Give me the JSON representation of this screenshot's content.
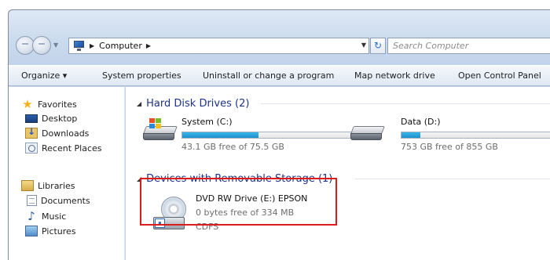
{
  "address": {
    "crumbs": [
      "Computer"
    ],
    "separator": "▶",
    "dropdown_icon": "chevron-down-icon",
    "refresh_icon": "refresh-icon"
  },
  "search": {
    "placeholder": "Search Computer"
  },
  "commands": [
    "Organize ▾",
    "System properties",
    "Uninstall or change a program",
    "Map network drive",
    "Open Control Panel"
  ],
  "nav": {
    "favorites": "Favorites",
    "desktop": "Desktop",
    "downloads": "Downloads",
    "recent_places": "Recent Places",
    "libraries": "Libraries",
    "documents": "Documents",
    "music": "Music",
    "pictures": "Pictures"
  },
  "groups": {
    "hard_disk": {
      "title": "Hard Disk Drives (2)",
      "drives": [
        {
          "name": "System (C:)",
          "free": "43.1 GB free of 75.5 GB",
          "used_fraction": 0.43
        },
        {
          "name": "Data (D:)",
          "free": "753 GB free of 855 GB",
          "used_fraction": 0.12
        }
      ]
    },
    "removable": {
      "title": "Devices with Removable Storage (1)",
      "drives": [
        {
          "name": "DVD RW Drive (E:) EPSON",
          "free": "0 bytes free of 334 MB",
          "filesystem": "CDFS"
        }
      ]
    }
  },
  "colors": {
    "highlight": "#dc1c1c",
    "group_title": "#1e3287",
    "usage_bar": "#1d91cf"
  }
}
